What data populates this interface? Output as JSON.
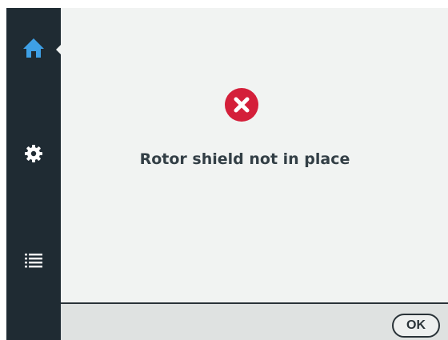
{
  "sidebar": {
    "items": [
      {
        "icon": "home-icon",
        "active": true,
        "color": "#3ea0e6"
      },
      {
        "icon": "gear-icon",
        "active": false,
        "color": "#ffffff"
      },
      {
        "icon": "list-icon",
        "active": false,
        "color": "#ffffff"
      }
    ]
  },
  "alert": {
    "icon": "error-x-icon",
    "icon_color": "#d41f3a",
    "message": "Rotor shield not in place"
  },
  "footer": {
    "ok_label": "OK"
  }
}
